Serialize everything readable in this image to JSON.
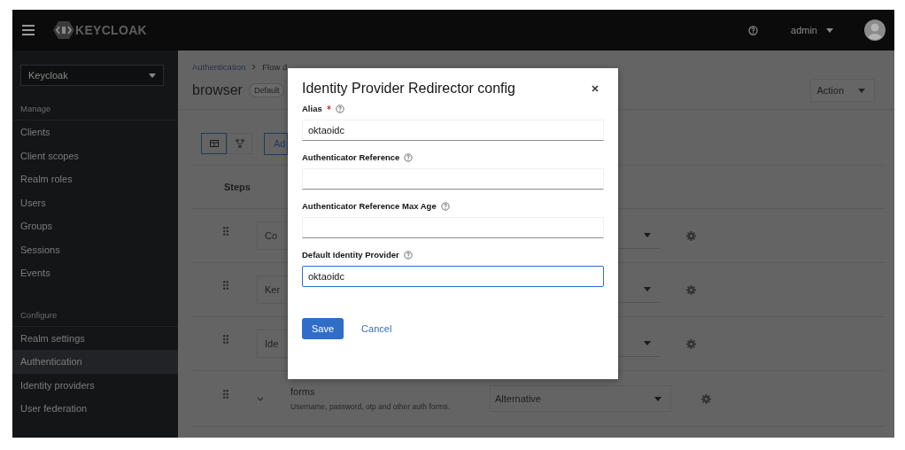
{
  "header": {
    "logo": "KEYCLOAK",
    "user": "admin"
  },
  "sidebar": {
    "realm": "Keycloak",
    "sections": [
      {
        "heading": "Manage",
        "items": [
          {
            "label": "Clients",
            "selected": false
          },
          {
            "label": "Client scopes",
            "selected": false
          },
          {
            "label": "Realm roles",
            "selected": false
          },
          {
            "label": "Users",
            "selected": false
          },
          {
            "label": "Groups",
            "selected": false
          },
          {
            "label": "Sessions",
            "selected": false
          },
          {
            "label": "Events",
            "selected": false
          }
        ]
      },
      {
        "heading": "Configure",
        "items": [
          {
            "label": "Realm settings",
            "selected": false
          },
          {
            "label": "Authentication",
            "selected": true
          },
          {
            "label": "Identity providers",
            "selected": false
          },
          {
            "label": "User federation",
            "selected": false
          }
        ]
      }
    ]
  },
  "page": {
    "breadcrumb": [
      "Authentication",
      "Flow d"
    ],
    "title": "browser",
    "badge": "Default",
    "action": "Action",
    "views": [
      {
        "kind": "table",
        "selected": true
      },
      {
        "kind": "diagram",
        "selected": false
      }
    ],
    "add_button": "Ad",
    "steps_header": "Steps",
    "rows": [
      {
        "kind": "step",
        "name": "Co"
      },
      {
        "kind": "step",
        "name": "Ker"
      },
      {
        "kind": "step",
        "name": "Ide"
      },
      {
        "kind": "flow",
        "name": "forms",
        "description": "Username, password, otp and other auth forms.",
        "requirement": "Alternative"
      }
    ]
  },
  "modal": {
    "title": "Identity Provider Redirector config",
    "fields": [
      {
        "label": "Alias",
        "required": true,
        "value": "oktaoidc",
        "focused": false
      },
      {
        "label": "Authenticator Reference",
        "required": false,
        "focused": false
      },
      {
        "label": "Authenticator Reference Max Age",
        "required": false,
        "focused": false
      },
      {
        "label": "Default Identity Provider",
        "required": false,
        "value": "oktaoidc",
        "focused": true
      }
    ],
    "save": "Save",
    "cancel": "Cancel"
  }
}
